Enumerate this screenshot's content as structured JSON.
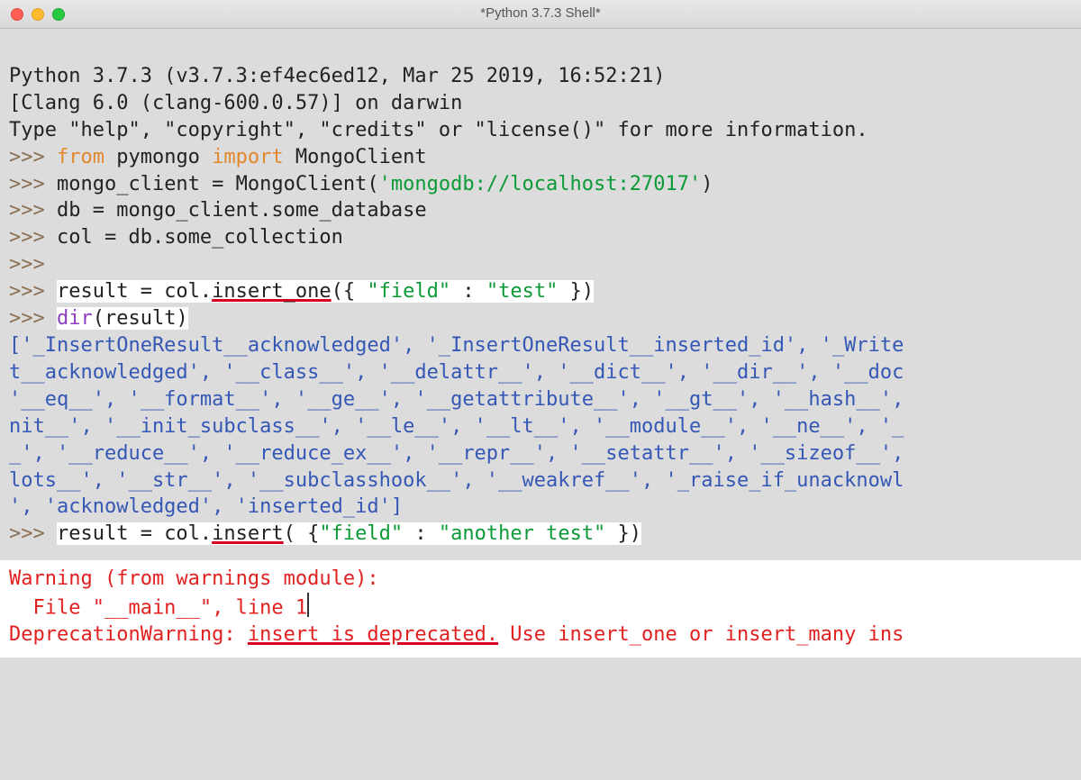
{
  "window": {
    "title": "*Python 3.7.3 Shell*"
  },
  "banner": {
    "line1": "Python 3.7.3 (v3.7.3:ef4ec6ed12, Mar 25 2019, 16:52:21) ",
    "line2": "[Clang 6.0 (clang-600.0.57)] on darwin",
    "line3": "Type \"help\", \"copyright\", \"credits\" or \"license()\" for more information."
  },
  "prompt": ">>> ",
  "code": {
    "kw_from": "from",
    "pymongo": " pymongo ",
    "kw_import": "import",
    "mongoclient": " MongoClient",
    "assign_mc1": "mongo_client = MongoClient(",
    "mc_uri": "'mongodb://localhost:27017'",
    "assign_mc2": ")",
    "assign_db": "db = mongo_client.some_database",
    "assign_col": "col = db.some_collection",
    "empty": "",
    "ins1_a": "result = col.",
    "ins1_b": "insert_one",
    "ins1_c": "({ ",
    "ins1_k": "\"field\"",
    "ins1_colon": " : ",
    "ins1_v": "\"test\"",
    "ins1_d": " })",
    "dir_a": "dir",
    "dir_b": "(result)",
    "ins2_a": "result = col.",
    "ins2_b": "insert",
    "ins2_c": "( {",
    "ins2_k": "\"field\"",
    "ins2_colon": " : ",
    "ins2_v": "\"another test\"",
    "ins2_d": " })"
  },
  "dir_output": "['_InsertOneResult__acknowledged', '_InsertOneResult__inserted_id', '_Write\nt__acknowledged', '__class__', '__delattr__', '__dict__', '__dir__', '__doc\n'__eq__', '__format__', '__ge__', '__getattribute__', '__gt__', '__hash__',\nnit__', '__init_subclass__', '__le__', '__lt__', '__module__', '__ne__', '_\n_', '__reduce__', '__reduce_ex__', '__repr__', '__setattr__', '__sizeof__',\nlots__', '__str__', '__subclasshook__', '__weakref__', '_raise_if_unacknowl\n', 'acknowledged', 'inserted_id']",
  "warning": {
    "l1": "Warning (from warnings module):",
    "l2a": "  File \"__main__\", line 1",
    "l3a": "DeprecationWarning: ",
    "l3b": "insert is deprecated.",
    "l3c": " Use insert_one or insert_many ins"
  }
}
